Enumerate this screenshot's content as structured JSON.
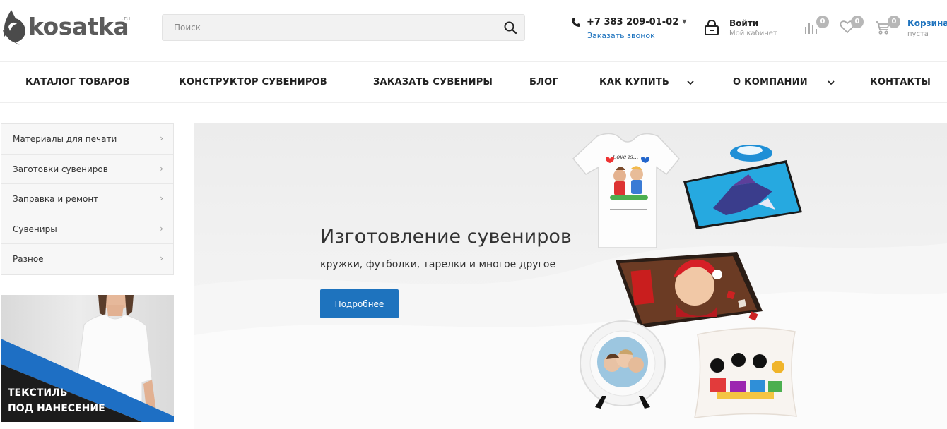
{
  "header": {
    "logo_text": "kosatka",
    "logo_suffix": ".ru",
    "search_placeholder": "Поиск",
    "phone": "+7 383 209-01-02",
    "callback_label": "Заказать звонок",
    "login_title": "Войти",
    "login_subtitle": "Мой кабинет",
    "compare_count": "0",
    "favorites_count": "0",
    "cart_count": "0",
    "cart_label": "Корзина",
    "cart_status": "пуста"
  },
  "nav": {
    "items": [
      {
        "label": "КАТАЛОГ ТОВАРОВ"
      },
      {
        "label": "КОНСТРУКТОР СУВЕНИРОВ"
      },
      {
        "label": "ЗАКАЗАТЬ СУВЕНИРЫ"
      },
      {
        "label": "БЛОГ"
      },
      {
        "label": "КАК КУПИТЬ"
      },
      {
        "label": "О КОМПАНИИ"
      },
      {
        "label": "КОНТАКТЫ"
      }
    ]
  },
  "sidebar": {
    "items": [
      {
        "label": "Материалы для печати"
      },
      {
        "label": "Заготовки сувениров"
      },
      {
        "label": "Заправка и ремонт"
      },
      {
        "label": "Сувениры"
      },
      {
        "label": "Разное"
      }
    ],
    "arrow": "›",
    "promo_line1": "ТЕКСТИЛЬ",
    "promo_line2": "ПОД НАНЕСЕНИЕ"
  },
  "banner": {
    "title": "Изготовление сувениров",
    "subtitle": "кружки, футболки, тарелки и многое другое",
    "button_label": "Подробнее",
    "tshirt_caption": "Love is..."
  },
  "colors": {
    "accent": "#1e73be",
    "badge": "#b7b7b7",
    "promo_blue": "#1e6fc4"
  }
}
